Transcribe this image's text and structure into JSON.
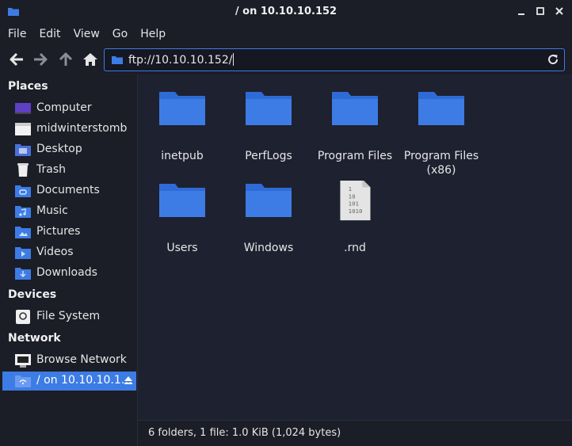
{
  "window": {
    "title": "/ on 10.10.10.152",
    "controls": [
      "minimize-icon",
      "maximize-icon",
      "close-icon"
    ]
  },
  "menu": [
    "File",
    "Edit",
    "View",
    "Go",
    "Help"
  ],
  "toolbar": {
    "buttons": [
      "back-arrow-icon",
      "forward-arrow-icon",
      "up-arrow-icon",
      "home-icon"
    ],
    "address": "ftp://10.10.10.152/"
  },
  "sidebar": {
    "places_header": "Places",
    "places": [
      {
        "label": "Computer",
        "icon": "computer-icon"
      },
      {
        "label": "midwinterstomb",
        "icon": "home-folder-icon"
      },
      {
        "label": "Desktop",
        "icon": "desktop-icon"
      },
      {
        "label": "Trash",
        "icon": "trash-icon"
      },
      {
        "label": "Documents",
        "icon": "documents-folder-icon"
      },
      {
        "label": "Music",
        "icon": "music-folder-icon"
      },
      {
        "label": "Pictures",
        "icon": "pictures-folder-icon"
      },
      {
        "label": "Videos",
        "icon": "videos-folder-icon"
      },
      {
        "label": "Downloads",
        "icon": "downloads-folder-icon"
      }
    ],
    "devices_header": "Devices",
    "devices": [
      {
        "label": "File System",
        "icon": "drive-icon"
      }
    ],
    "network_header": "Network",
    "network": [
      {
        "label": "Browse Network",
        "icon": "network-icon"
      },
      {
        "label": "/ on 10.10.10.1…",
        "icon": "network-share-icon",
        "selected": true
      }
    ]
  },
  "files": [
    {
      "name": "inetpub",
      "type": "folder"
    },
    {
      "name": "PerfLogs",
      "type": "folder"
    },
    {
      "name": "Program Files",
      "type": "folder"
    },
    {
      "name": "Program Files (x86)",
      "type": "folder"
    },
    {
      "name": "Users",
      "type": "folder"
    },
    {
      "name": "Windows",
      "type": "folder"
    },
    {
      "name": ".rnd",
      "type": "binary-file"
    }
  ],
  "status": "6 folders, 1 file: 1.0 KiB (1,024 bytes)",
  "colors": {
    "accent": "#3d7ce4",
    "folder": "#3d7ce4",
    "background": "#1e2130",
    "panel": "#1b1d27"
  }
}
